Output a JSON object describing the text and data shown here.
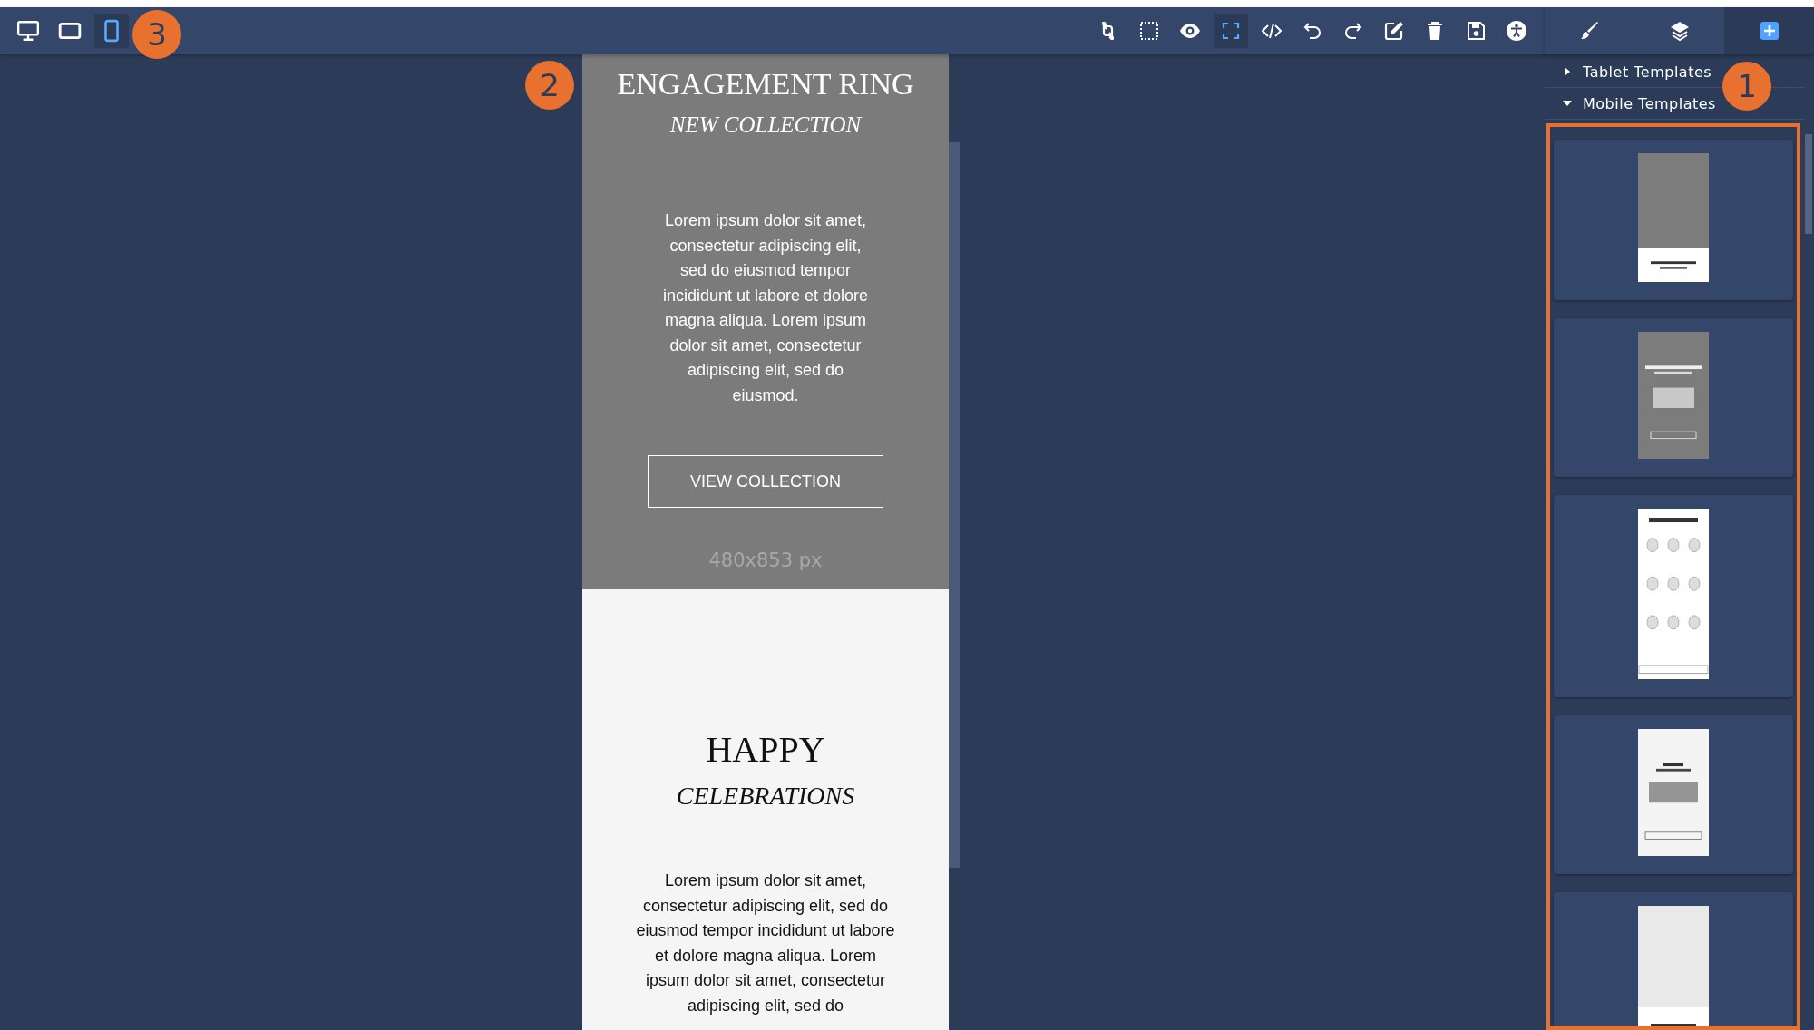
{
  "devices": [
    {
      "kind": "desktop",
      "selected": false
    },
    {
      "kind": "tablet",
      "selected": false
    },
    {
      "kind": "mobile",
      "selected": true
    }
  ],
  "tools": [
    {
      "kind": "swap",
      "selected": false
    },
    {
      "kind": "select",
      "selected": false
    },
    {
      "kind": "preview",
      "selected": false
    },
    {
      "kind": "fullscreen",
      "selected": true
    },
    {
      "kind": "code",
      "selected": false
    },
    {
      "kind": "undo",
      "selected": false
    },
    {
      "kind": "redo",
      "selected": false
    },
    {
      "kind": "edit",
      "selected": false
    },
    {
      "kind": "delete",
      "selected": false
    },
    {
      "kind": "save",
      "selected": false
    },
    {
      "kind": "accessibility",
      "selected": false
    }
  ],
  "panel_tabs": [
    {
      "kind": "style",
      "selected": false
    },
    {
      "kind": "layers",
      "selected": false
    },
    {
      "kind": "blocks",
      "selected": true
    }
  ],
  "callouts": [
    "1",
    "2",
    "3"
  ],
  "sections": [
    {
      "label": "Tablet Templates",
      "expanded": false
    },
    {
      "label": "Mobile Templates",
      "expanded": true
    }
  ],
  "templates": [
    {
      "kind": "banner"
    },
    {
      "kind": "promo"
    },
    {
      "kind": "shapes"
    },
    {
      "kind": "celebration"
    },
    {
      "kind": "bridal"
    }
  ],
  "canvas": {
    "hero": {
      "title": "ENGAGEMENT RING",
      "subtitle": "NEW COLLECTION",
      "body": "Lorem ipsum dolor sit amet, consectetur adipiscing elit, sed do eiusmod tempor incididunt ut labore et dolore magna aliqua. Lorem ipsum dolor sit amet, consectetur adipiscing elit, sed do eiusmod.",
      "button": "VIEW COLLECTION",
      "size": "480x853 px"
    },
    "second": {
      "title": "HAPPY",
      "subtitle": "CELEBRATIONS",
      "body": "Lorem ipsum dolor sit amet, consectetur adipiscing elit, sed do eiusmod tempor incididunt ut labore et dolore magna aliqua. Lorem ipsum dolor sit amet, consectetur adipiscing elit, sed do"
    }
  }
}
